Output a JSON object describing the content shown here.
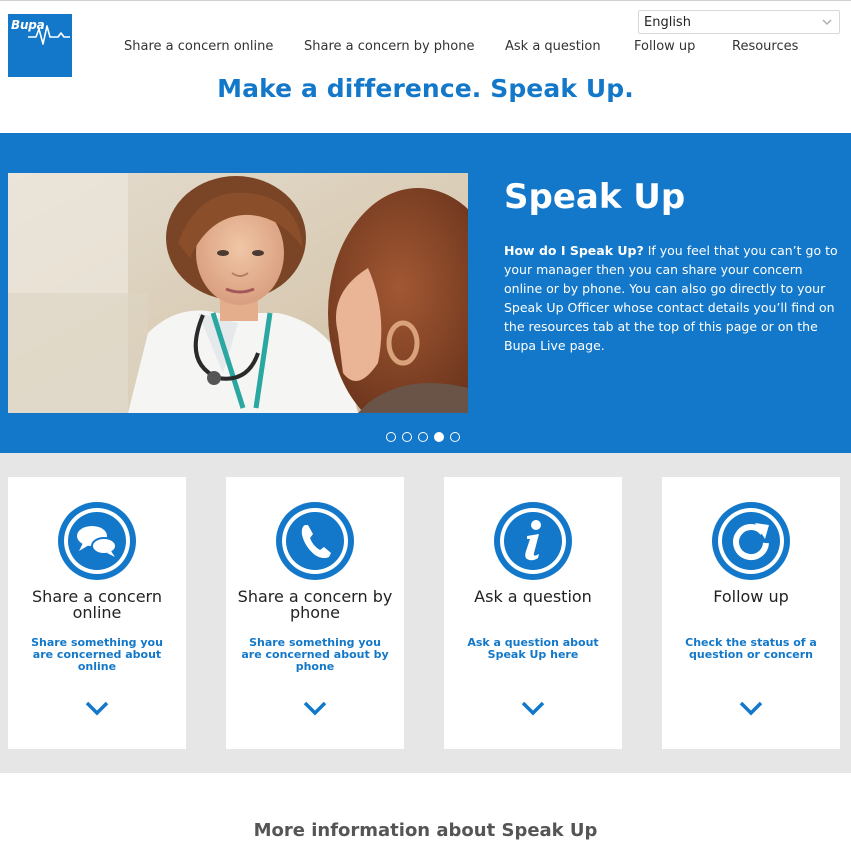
{
  "brand": {
    "logo_text": "Bupa",
    "color": "#1378c9"
  },
  "language": {
    "selected": "English"
  },
  "nav": {
    "items": [
      {
        "label": "Share a concern online"
      },
      {
        "label": "Share a concern by phone"
      },
      {
        "label": "Ask a question"
      },
      {
        "label": "Follow up"
      },
      {
        "label": "Resources"
      }
    ]
  },
  "tagline": "Make a difference. Speak Up.",
  "hero": {
    "title": "Speak Up",
    "lead": "How do I Speak Up?",
    "body": " If you feel that you can’t go to your manager then you can share your concern online or by phone. You can also go directly to your Speak Up Officer whose contact details you’ll find on the resources tab at the top of this page or on the Bupa Live page.",
    "slide_count": 5,
    "active_slide": 4
  },
  "cards": [
    {
      "title": "Share a concern online",
      "description": "Share something you are concerned about online",
      "icon": "speech-bubbles-icon"
    },
    {
      "title": "Share a concern by phone",
      "description": "Share something you are concerned about by phone",
      "icon": "phone-icon"
    },
    {
      "title": "Ask a question",
      "description": "Ask a question about Speak Up here",
      "icon": "info-icon"
    },
    {
      "title": "Follow up",
      "description": "Check the status of a question or concern",
      "icon": "refresh-icon"
    }
  ],
  "more_info": "More information about Speak Up"
}
